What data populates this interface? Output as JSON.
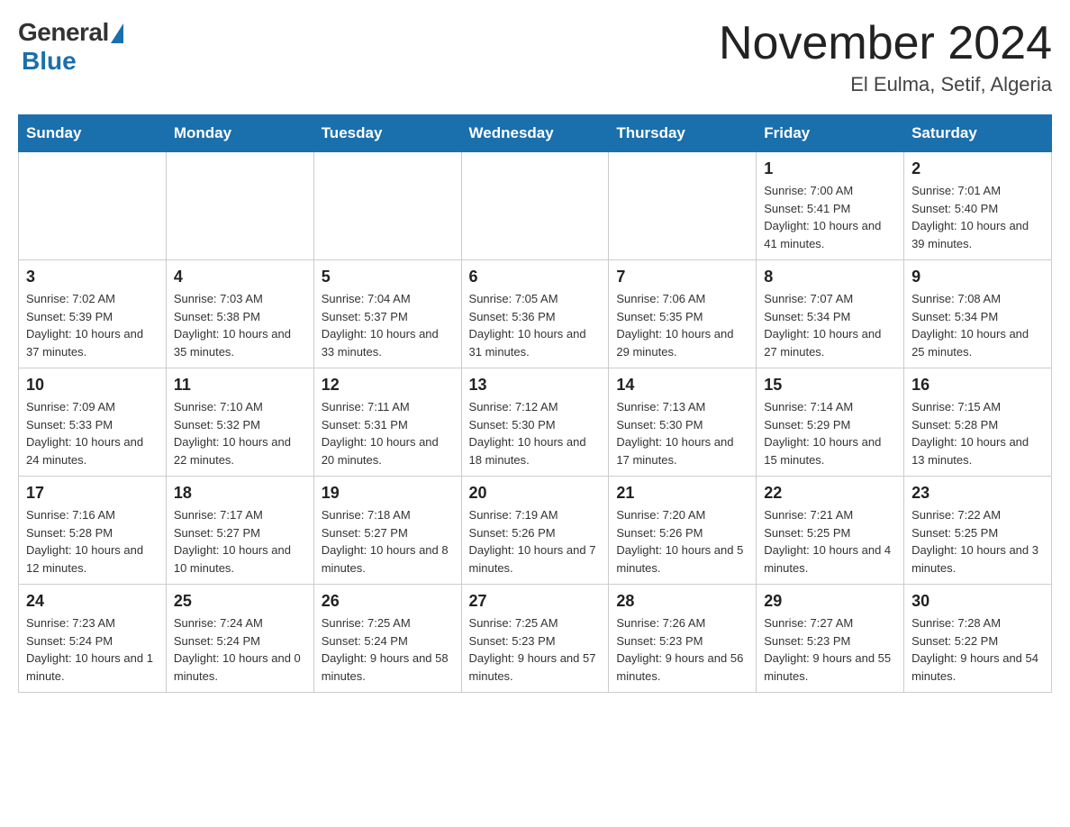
{
  "header": {
    "logo_general": "General",
    "logo_blue": "Blue",
    "month_title": "November 2024",
    "location": "El Eulma, Setif, Algeria"
  },
  "days_of_week": [
    "Sunday",
    "Monday",
    "Tuesday",
    "Wednesday",
    "Thursday",
    "Friday",
    "Saturday"
  ],
  "weeks": [
    {
      "days": [
        {
          "number": "",
          "info": ""
        },
        {
          "number": "",
          "info": ""
        },
        {
          "number": "",
          "info": ""
        },
        {
          "number": "",
          "info": ""
        },
        {
          "number": "",
          "info": ""
        },
        {
          "number": "1",
          "info": "Sunrise: 7:00 AM\nSunset: 5:41 PM\nDaylight: 10 hours and 41 minutes."
        },
        {
          "number": "2",
          "info": "Sunrise: 7:01 AM\nSunset: 5:40 PM\nDaylight: 10 hours and 39 minutes."
        }
      ]
    },
    {
      "days": [
        {
          "number": "3",
          "info": "Sunrise: 7:02 AM\nSunset: 5:39 PM\nDaylight: 10 hours and 37 minutes."
        },
        {
          "number": "4",
          "info": "Sunrise: 7:03 AM\nSunset: 5:38 PM\nDaylight: 10 hours and 35 minutes."
        },
        {
          "number": "5",
          "info": "Sunrise: 7:04 AM\nSunset: 5:37 PM\nDaylight: 10 hours and 33 minutes."
        },
        {
          "number": "6",
          "info": "Sunrise: 7:05 AM\nSunset: 5:36 PM\nDaylight: 10 hours and 31 minutes."
        },
        {
          "number": "7",
          "info": "Sunrise: 7:06 AM\nSunset: 5:35 PM\nDaylight: 10 hours and 29 minutes."
        },
        {
          "number": "8",
          "info": "Sunrise: 7:07 AM\nSunset: 5:34 PM\nDaylight: 10 hours and 27 minutes."
        },
        {
          "number": "9",
          "info": "Sunrise: 7:08 AM\nSunset: 5:34 PM\nDaylight: 10 hours and 25 minutes."
        }
      ]
    },
    {
      "days": [
        {
          "number": "10",
          "info": "Sunrise: 7:09 AM\nSunset: 5:33 PM\nDaylight: 10 hours and 24 minutes."
        },
        {
          "number": "11",
          "info": "Sunrise: 7:10 AM\nSunset: 5:32 PM\nDaylight: 10 hours and 22 minutes."
        },
        {
          "number": "12",
          "info": "Sunrise: 7:11 AM\nSunset: 5:31 PM\nDaylight: 10 hours and 20 minutes."
        },
        {
          "number": "13",
          "info": "Sunrise: 7:12 AM\nSunset: 5:30 PM\nDaylight: 10 hours and 18 minutes."
        },
        {
          "number": "14",
          "info": "Sunrise: 7:13 AM\nSunset: 5:30 PM\nDaylight: 10 hours and 17 minutes."
        },
        {
          "number": "15",
          "info": "Sunrise: 7:14 AM\nSunset: 5:29 PM\nDaylight: 10 hours and 15 minutes."
        },
        {
          "number": "16",
          "info": "Sunrise: 7:15 AM\nSunset: 5:28 PM\nDaylight: 10 hours and 13 minutes."
        }
      ]
    },
    {
      "days": [
        {
          "number": "17",
          "info": "Sunrise: 7:16 AM\nSunset: 5:28 PM\nDaylight: 10 hours and 12 minutes."
        },
        {
          "number": "18",
          "info": "Sunrise: 7:17 AM\nSunset: 5:27 PM\nDaylight: 10 hours and 10 minutes."
        },
        {
          "number": "19",
          "info": "Sunrise: 7:18 AM\nSunset: 5:27 PM\nDaylight: 10 hours and 8 minutes."
        },
        {
          "number": "20",
          "info": "Sunrise: 7:19 AM\nSunset: 5:26 PM\nDaylight: 10 hours and 7 minutes."
        },
        {
          "number": "21",
          "info": "Sunrise: 7:20 AM\nSunset: 5:26 PM\nDaylight: 10 hours and 5 minutes."
        },
        {
          "number": "22",
          "info": "Sunrise: 7:21 AM\nSunset: 5:25 PM\nDaylight: 10 hours and 4 minutes."
        },
        {
          "number": "23",
          "info": "Sunrise: 7:22 AM\nSunset: 5:25 PM\nDaylight: 10 hours and 3 minutes."
        }
      ]
    },
    {
      "days": [
        {
          "number": "24",
          "info": "Sunrise: 7:23 AM\nSunset: 5:24 PM\nDaylight: 10 hours and 1 minute."
        },
        {
          "number": "25",
          "info": "Sunrise: 7:24 AM\nSunset: 5:24 PM\nDaylight: 10 hours and 0 minutes."
        },
        {
          "number": "26",
          "info": "Sunrise: 7:25 AM\nSunset: 5:24 PM\nDaylight: 9 hours and 58 minutes."
        },
        {
          "number": "27",
          "info": "Sunrise: 7:25 AM\nSunset: 5:23 PM\nDaylight: 9 hours and 57 minutes."
        },
        {
          "number": "28",
          "info": "Sunrise: 7:26 AM\nSunset: 5:23 PM\nDaylight: 9 hours and 56 minutes."
        },
        {
          "number": "29",
          "info": "Sunrise: 7:27 AM\nSunset: 5:23 PM\nDaylight: 9 hours and 55 minutes."
        },
        {
          "number": "30",
          "info": "Sunrise: 7:28 AM\nSunset: 5:22 PM\nDaylight: 9 hours and 54 minutes."
        }
      ]
    }
  ]
}
